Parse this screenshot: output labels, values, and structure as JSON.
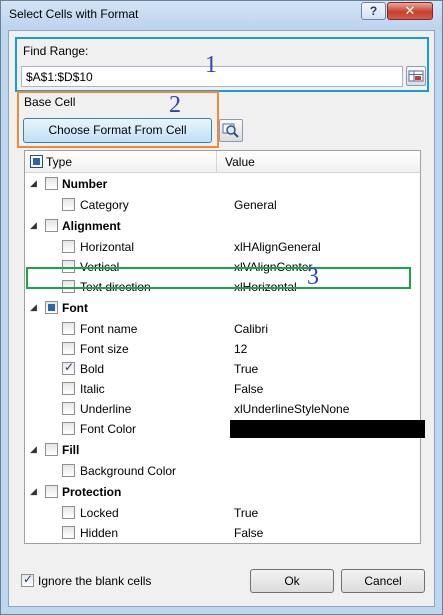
{
  "window": {
    "title": "Select Cells with Format",
    "help_label": "?",
    "close_label": "✕"
  },
  "find_range": {
    "label": "Find Range:",
    "value": "$A$1:$D$10",
    "marker": "1"
  },
  "base_cell": {
    "label": "Base Cell",
    "button_label": "Choose Format From Cell",
    "marker": "2"
  },
  "grid": {
    "header_type": "Type",
    "header_value": "Value",
    "rows": [
      {
        "label": "Number",
        "value": ""
      },
      {
        "label": "Category",
        "value": "General"
      },
      {
        "label": "Alignment",
        "value": ""
      },
      {
        "label": "Horizontal",
        "value": "xlHAlignGeneral"
      },
      {
        "label": "Vertical",
        "value": "xlVAlignCenter"
      },
      {
        "label": "Text direction",
        "value": "xlHorizontal"
      },
      {
        "label": "Font",
        "value": ""
      },
      {
        "label": "Font name",
        "value": "Calibri"
      },
      {
        "label": "Font size",
        "value": "12"
      },
      {
        "label": "Bold",
        "value": "True"
      },
      {
        "label": "Italic",
        "value": "False"
      },
      {
        "label": "Underline",
        "value": "xlUnderlineStyleNone"
      },
      {
        "label": "Font Color",
        "value": ""
      },
      {
        "label": "Fill",
        "value": ""
      },
      {
        "label": "Background Color",
        "value": ""
      },
      {
        "label": "Protection",
        "value": ""
      },
      {
        "label": "Locked",
        "value": "True"
      },
      {
        "label": "Hidden",
        "value": "False"
      }
    ],
    "font_color_swatch": "#000000",
    "marker": "3"
  },
  "footer": {
    "ignore_blank_label": "Ignore the blank cells",
    "ok_label": "Ok",
    "cancel_label": "Cancel"
  },
  "colors": {
    "find_range_box": "#1d9ad6",
    "base_cell_box": "#ef8b34",
    "bold_row_box": "#1aa350",
    "marker": "#2b46b8"
  }
}
